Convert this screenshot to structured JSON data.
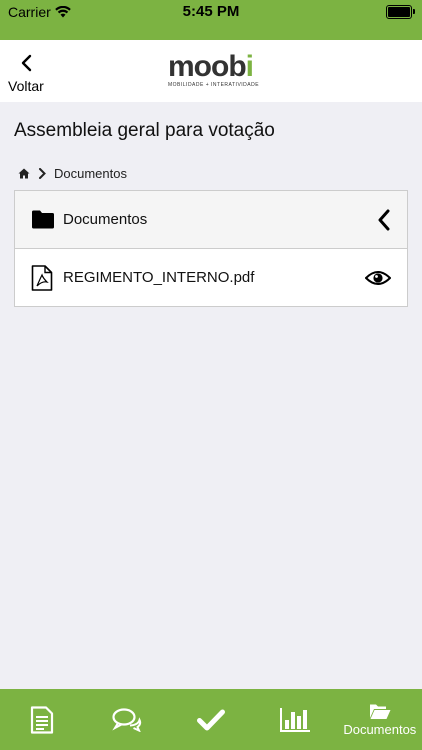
{
  "status": {
    "carrier": "Carrier",
    "time": "5:45 PM"
  },
  "header": {
    "back_label": "Voltar",
    "logo_text": "moob",
    "logo_i": "i",
    "logo_tagline": "MOBILIDADE + INTERATIVIDADE"
  },
  "page": {
    "title": "Assembleia geral para votação"
  },
  "breadcrumb": {
    "current": "Documentos"
  },
  "files": {
    "folder": {
      "name": "Documentos"
    },
    "items": [
      {
        "name": "REGIMENTO_INTERNO.pdf"
      }
    ]
  },
  "tabs": {
    "active_label": "Documentos"
  },
  "colors": {
    "accent": "#7cb342"
  }
}
